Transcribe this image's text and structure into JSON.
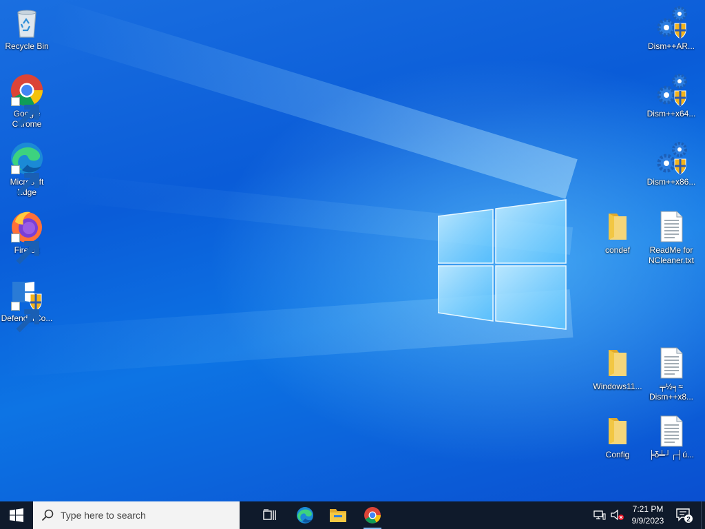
{
  "desktop": {
    "left_icons": [
      {
        "label": "Recycle Bin",
        "icon": "recycle-bin-icon"
      },
      {
        "label": "Google\nChrome",
        "icon": "chrome-icon",
        "shortcut": true
      },
      {
        "label": "Microsoft\nEdge",
        "icon": "edge-icon",
        "shortcut": true
      },
      {
        "label": "Firefox",
        "icon": "firefox-icon",
        "shortcut": true
      },
      {
        "label": "DefenderCo...",
        "icon": "defender-control-icon",
        "shortcut": true
      }
    ],
    "right_icons": [
      {
        "label": "Dism++AR...",
        "icon": "gear-shield-icon"
      },
      {
        "label": "Dism++x64...",
        "icon": "gear-shield-icon"
      },
      {
        "label": "Dism++x86...",
        "icon": "gear-shield-icon"
      },
      {
        "label": "condef",
        "icon": "folder-icon"
      },
      {
        "label": "ReadMe for\nNCleaner.txt",
        "icon": "text-file-icon"
      },
      {
        "label": "Windows11...",
        "icon": "folder-icon"
      },
      {
        "label": "╤½╕≈\nDism++x8...",
        "icon": "text-file-icon"
      },
      {
        "label": "Config",
        "icon": "folder-icon"
      },
      {
        "label": "╞δ╧┘┌┤ú...",
        "icon": "text-file-icon"
      }
    ]
  },
  "taskbar": {
    "search_placeholder": "Type here to search",
    "pinned": [
      "edge-icon",
      "file-explorer-icon",
      "chrome-icon"
    ],
    "clock": {
      "time": "7:21 PM",
      "date": "9/9/2023"
    },
    "notification_count": "2"
  },
  "colors": {
    "taskbar_bg": "#0f1a2b",
    "desktop_blue": "#0a5cd8",
    "folder_yellow": "#f5c842"
  }
}
